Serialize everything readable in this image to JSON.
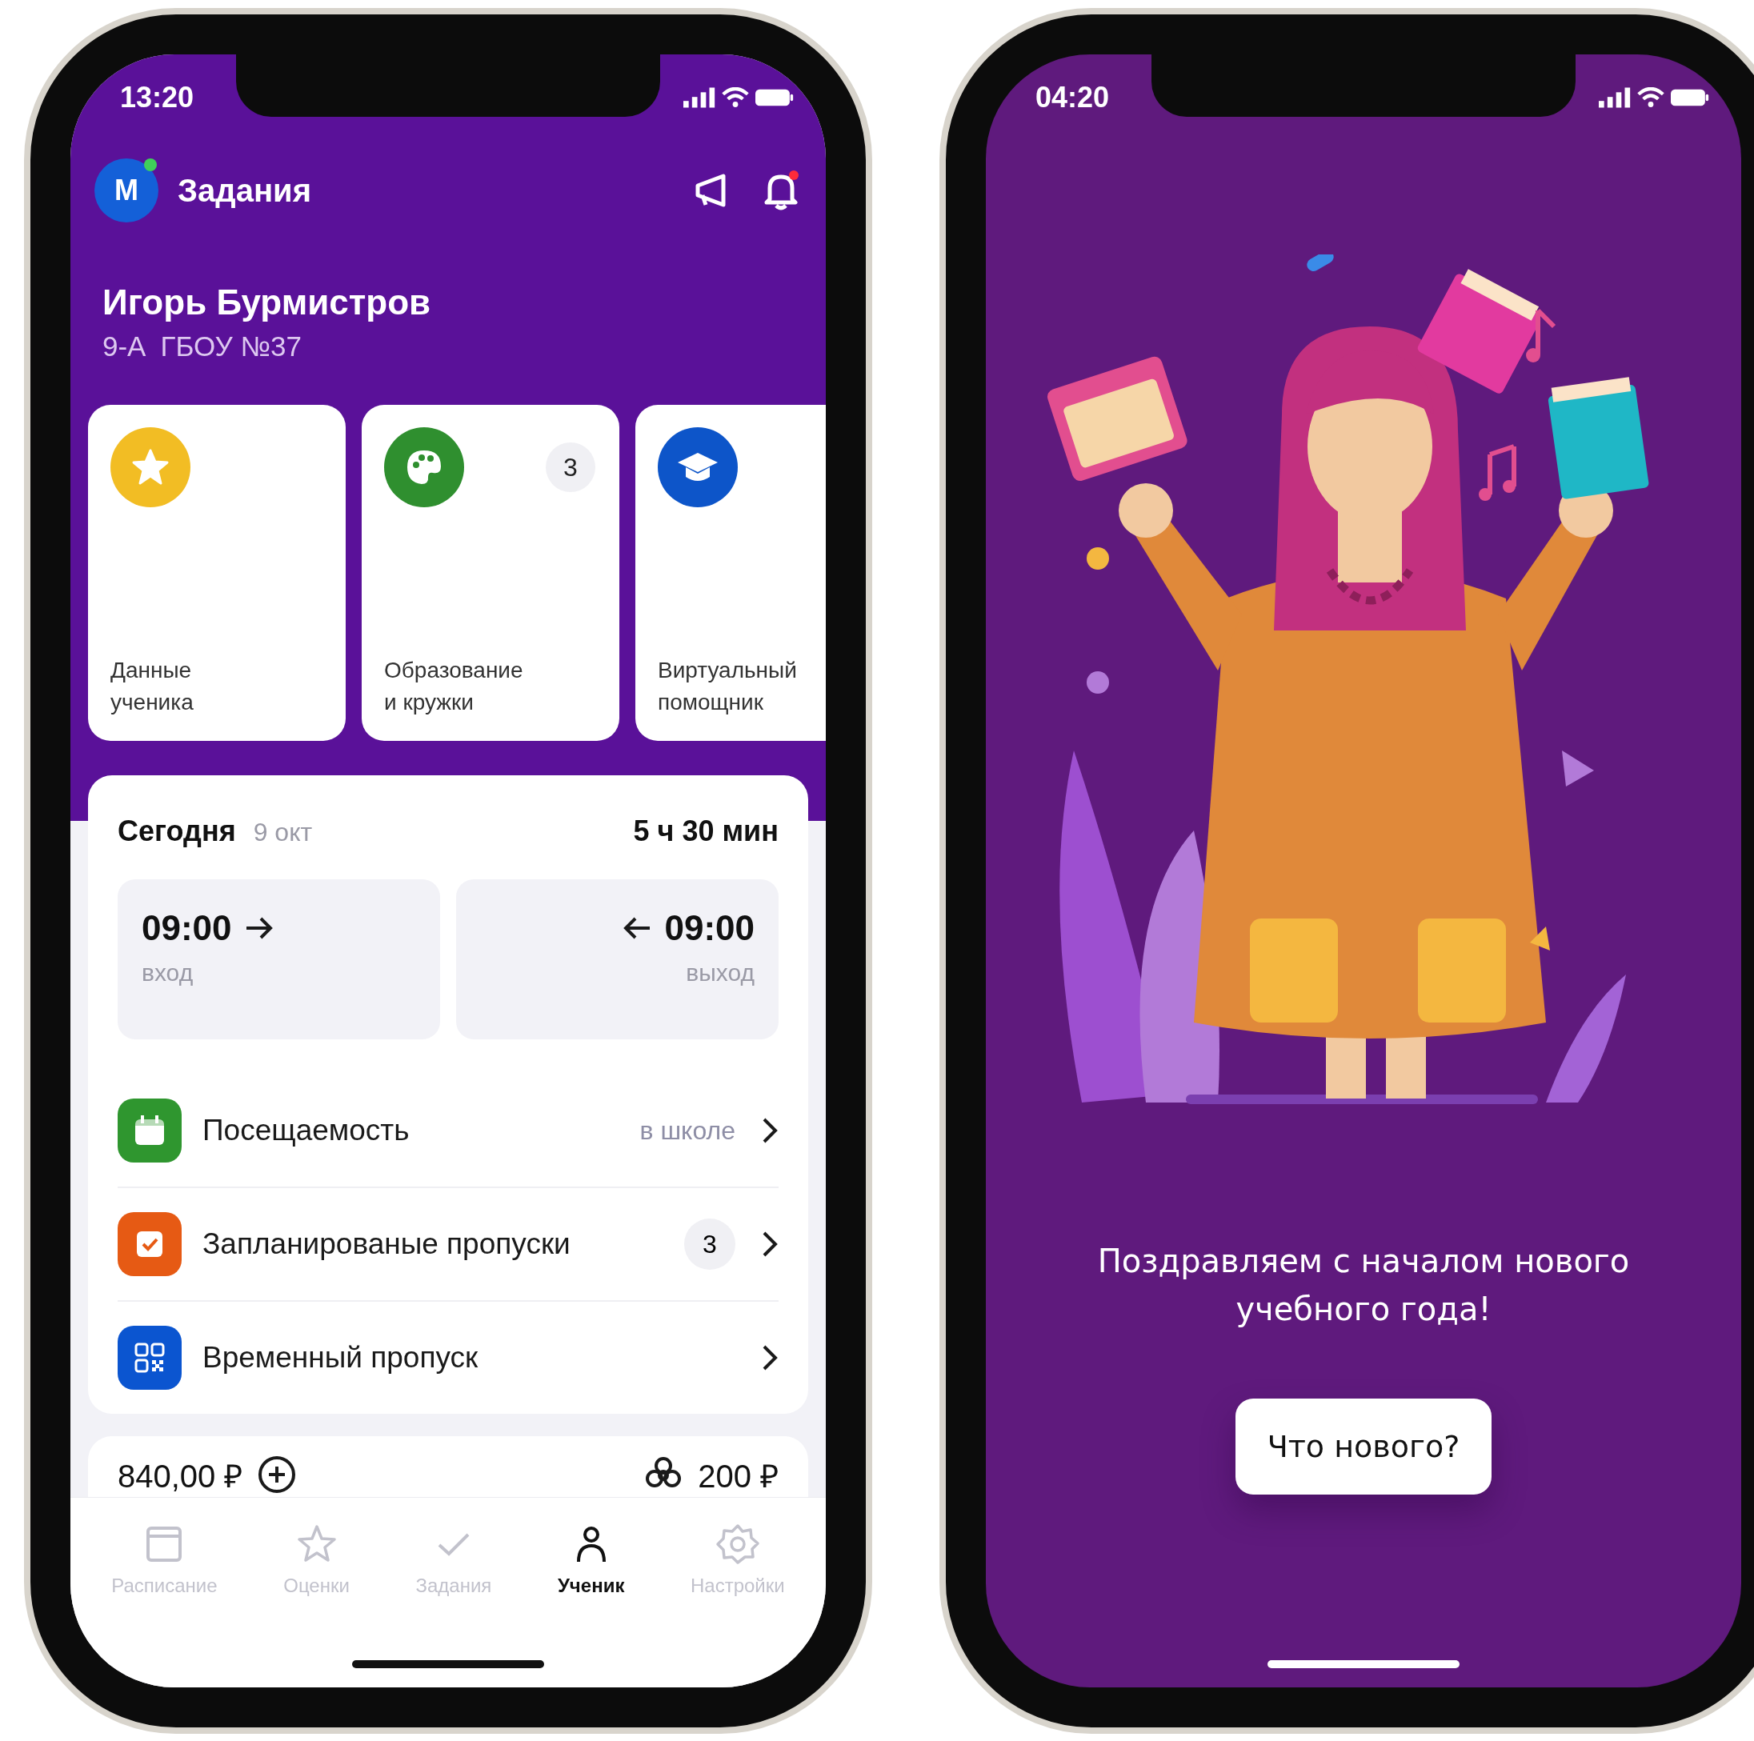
{
  "phones": [
    {
      "kind": "student",
      "status_bar": {
        "time": "13:20"
      },
      "header": {
        "avatar_letter": "М",
        "online": true,
        "title": "Задания",
        "bell_unread": true
      },
      "profile": {
        "name": "Игорь Бурмистров",
        "class": "9-А",
        "school": "ГБОУ №37"
      },
      "tiles": [
        {
          "label": "Данные\nученика",
          "color": "#f2bd24"
        },
        {
          "label": "Образование\nи кружки",
          "color": "#2f8f2f",
          "badge": "3"
        },
        {
          "label": "Виртуальный\nпомощник",
          "color": "#0d55c9"
        }
      ],
      "today": {
        "title": "Сегодня",
        "date": "9 окт",
        "duration": "5 ч 30 мин",
        "entry_time": "09:00",
        "entry_label": "вход",
        "exit_time": "09:00",
        "exit_label": "выход"
      },
      "rows": [
        {
          "label": "Посещаемость",
          "value": "в школе",
          "color": "#2f962f"
        },
        {
          "label": "Запланированые пропуски",
          "badge": "3",
          "color": "#e65a14"
        },
        {
          "label": "Временный пропуск",
          "color": "#0b55d0"
        }
      ],
      "wallet": {
        "balance": "840,00 ₽",
        "bonus": "200 ₽"
      },
      "tabs": [
        {
          "label": "Расписание",
          "selected": false
        },
        {
          "label": "Оценки",
          "selected": false
        },
        {
          "label": "Задания",
          "selected": false
        },
        {
          "label": "Ученик",
          "selected": true
        },
        {
          "label": "Настройки",
          "selected": false
        }
      ]
    },
    {
      "kind": "greeting",
      "status_bar": {
        "time": "04:20"
      },
      "message": "Поздравляем с началом нового учебного года!",
      "button": "Что нового?"
    }
  ]
}
